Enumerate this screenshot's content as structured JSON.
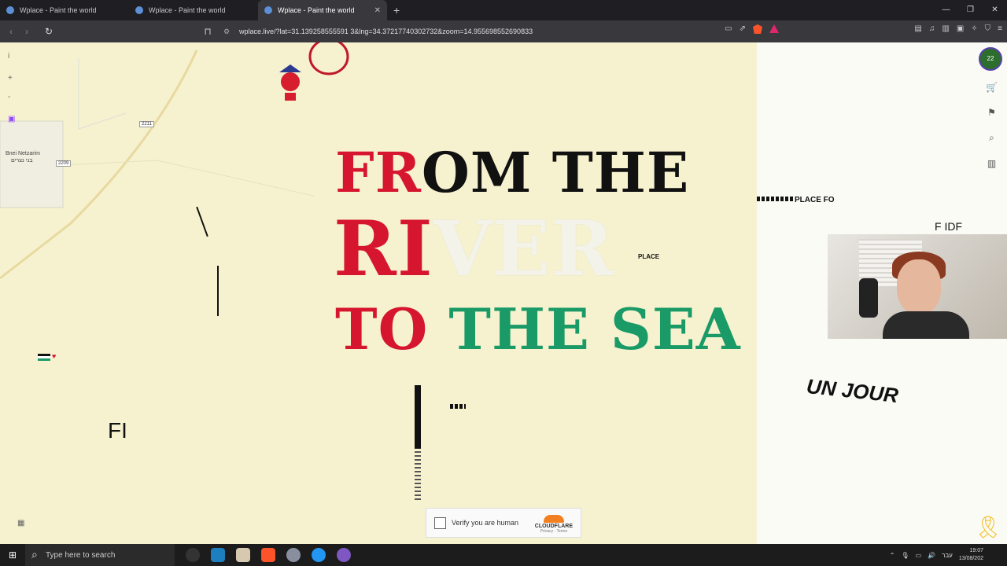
{
  "tabs": [
    {
      "title": "Wplace - Paint the world",
      "active": false
    },
    {
      "title": "Wplace - Paint the world",
      "active": false
    },
    {
      "title": "Wplace - Paint the world",
      "active": true
    }
  ],
  "toolbar": {
    "url": "wplace.live/?lat=31.139258555591 3&lng=34.37217740302732&zoom=14.955698552690833"
  },
  "map": {
    "labels": {
      "place_name": "Bnei Netzarim",
      "place_name_he": "בני נצרים",
      "road1": "2211",
      "road2": "2209"
    },
    "art_text": {
      "line1_red": "FR",
      "line1_black": "OM THE",
      "line2_red": "RI",
      "line2_white": "VER",
      "line3_red": "TO",
      "line3_green": " THE SEA",
      "place_fo": "PLACE FO",
      "place": "PLACE",
      "f_idf": "F IDF",
      "un_jour": "UN JOUR",
      "fi": "FI"
    }
  },
  "captcha": {
    "label": "Verify you are human",
    "brand": "CLOUDFLARE",
    "links": "Privacy · Terms"
  },
  "avatar": {
    "level": "22"
  },
  "taskbar": {
    "search_placeholder": "Type here to search",
    "language": "עבר",
    "time": "19:07",
    "date": "13/08/202"
  }
}
